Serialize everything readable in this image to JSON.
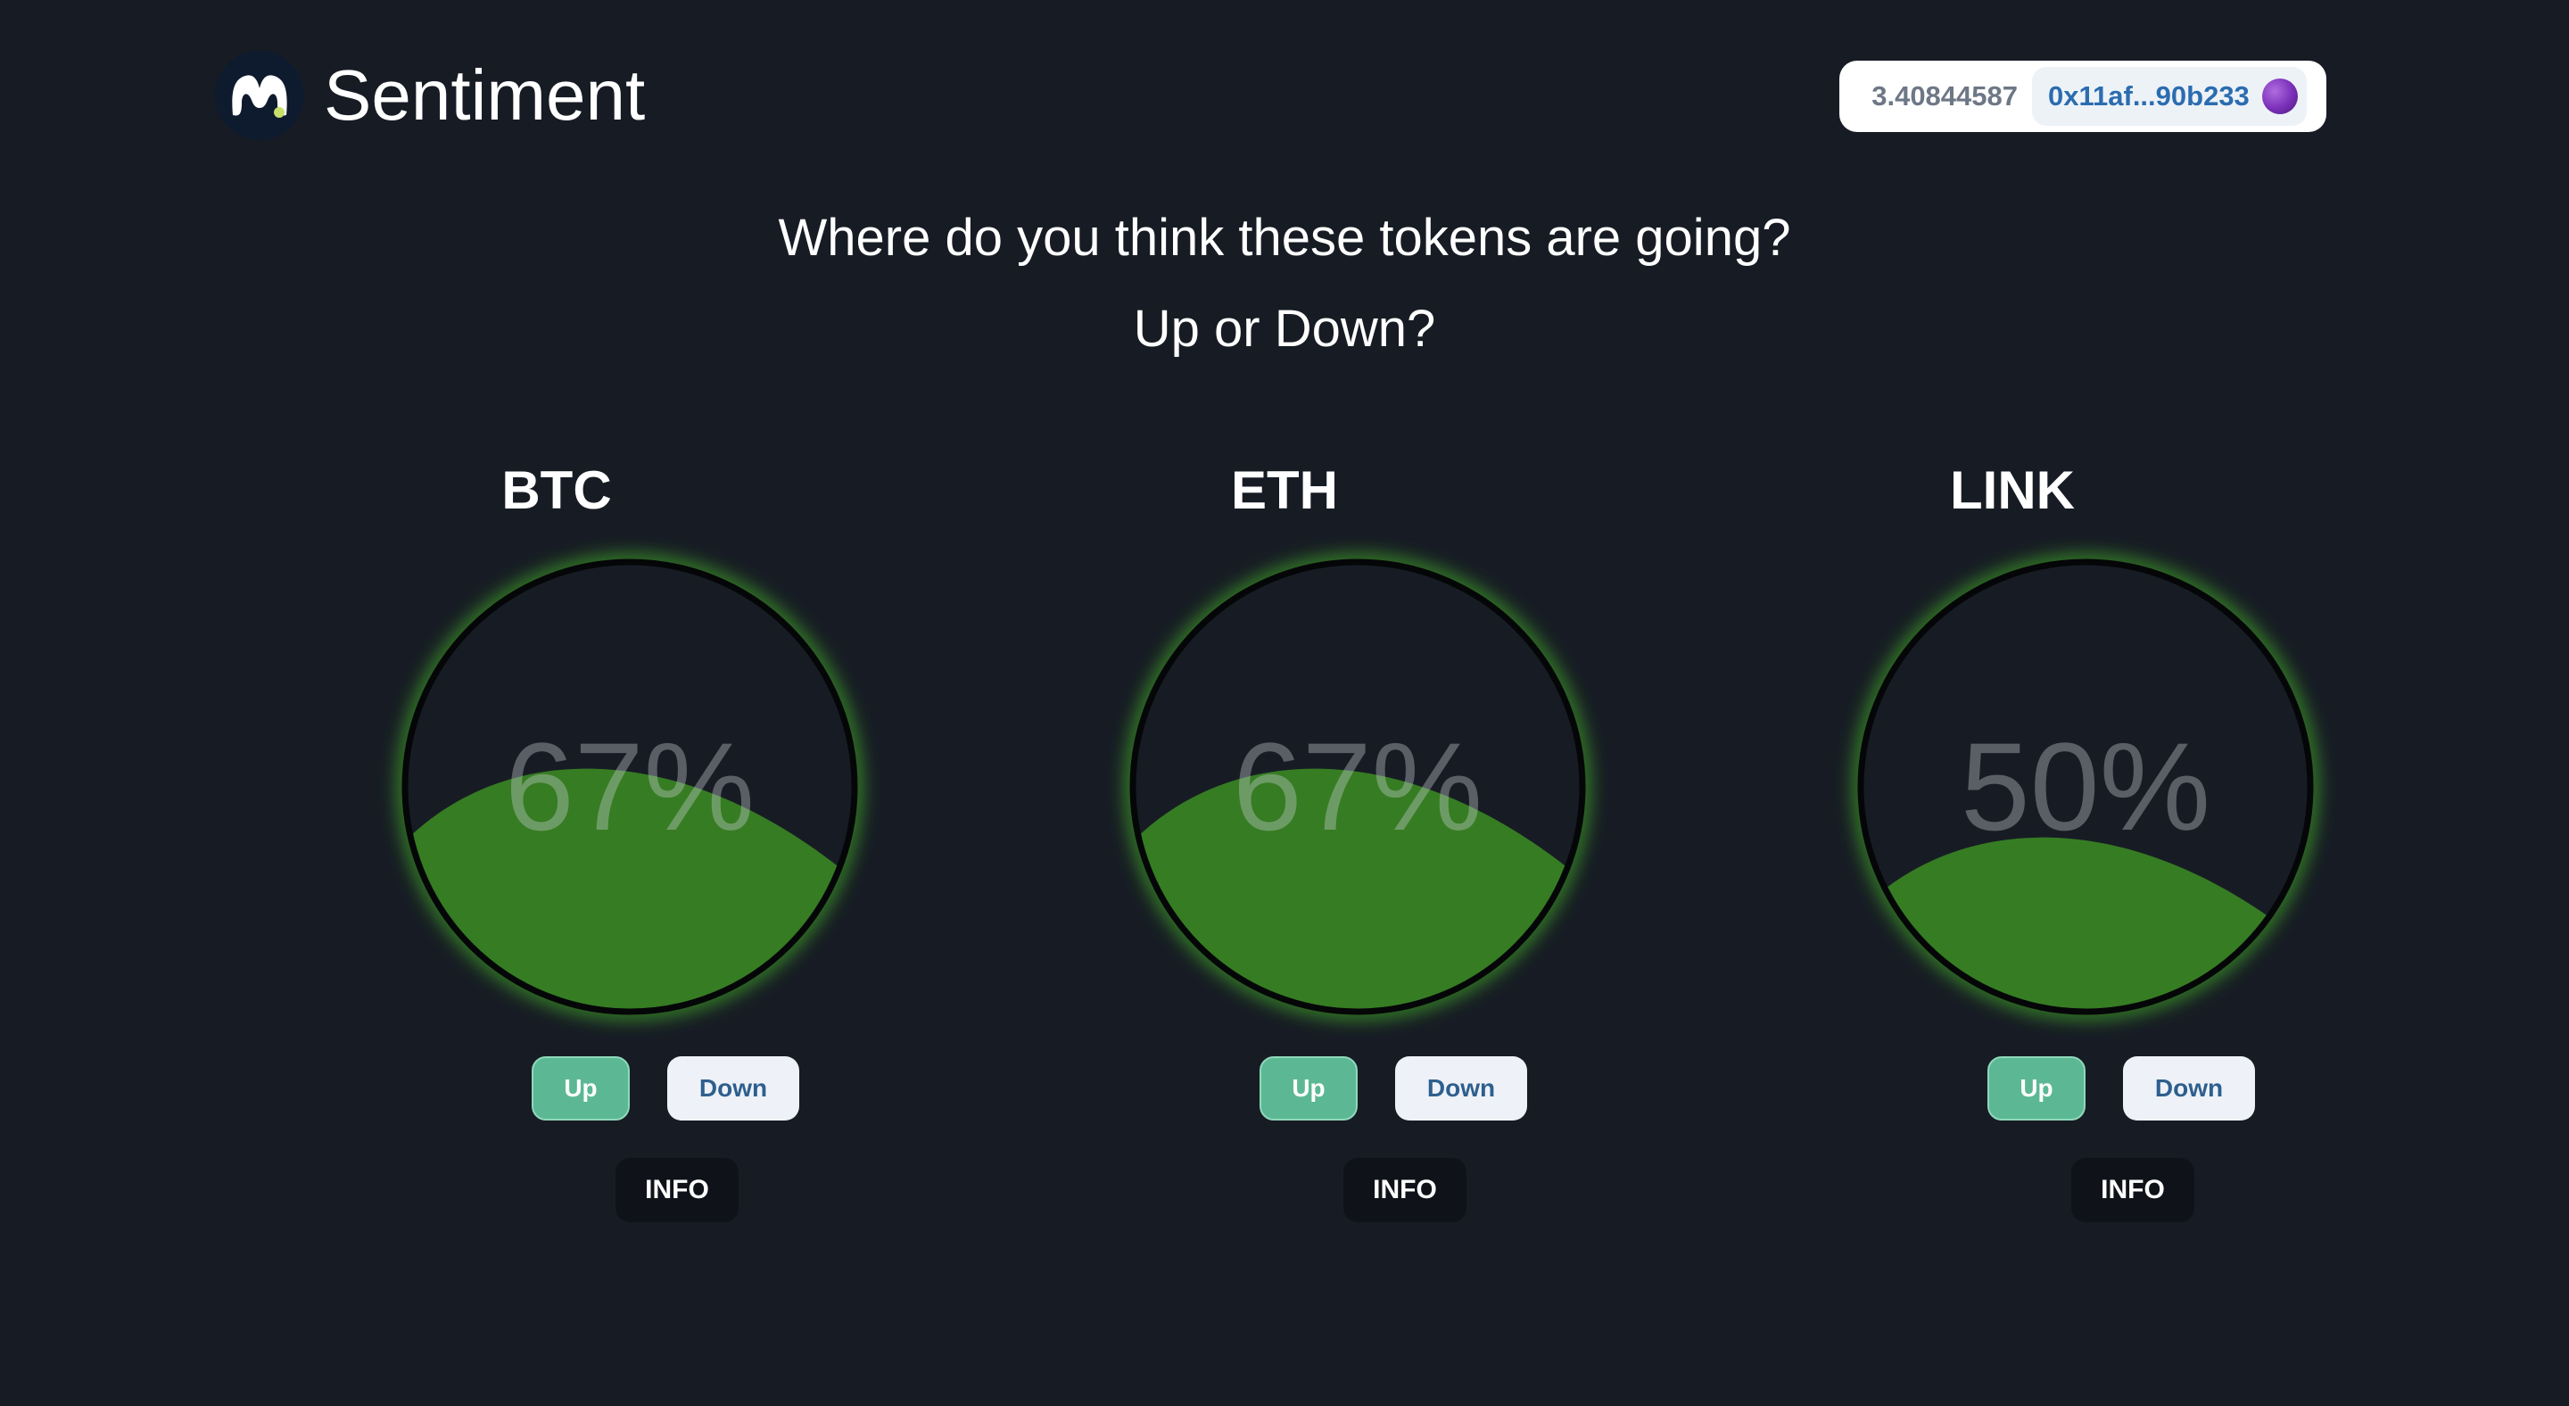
{
  "header": {
    "brand": "Sentiment",
    "logo_icon": "sentiment-logo-icon",
    "wallet": {
      "balance": "3.40844587",
      "address": "0x11af...90b233",
      "avatar_icon": "wallet-avatar-icon"
    }
  },
  "main": {
    "question_line1": "Where do you think these tokens are going?",
    "question_line2": "Up or Down?"
  },
  "tokens": [
    {
      "symbol": "BTC",
      "percent_label": "67%",
      "percent": 67,
      "up_label": "Up",
      "down_label": "Down",
      "info_label": "INFO"
    },
    {
      "symbol": "ETH",
      "percent_label": "67%",
      "percent": 67,
      "up_label": "Up",
      "down_label": "Down",
      "info_label": "INFO"
    },
    {
      "symbol": "LINK",
      "percent_label": "50%",
      "percent": 50,
      "up_label": "Up",
      "down_label": "Down",
      "info_label": "INFO"
    }
  ],
  "colors": {
    "background": "#171c24",
    "gauge_fill": "#367c23",
    "gauge_glow": "#3ea126",
    "up_button": "#5cb894",
    "down_button": "#eef2f8",
    "address_text": "#2b6cb0"
  }
}
